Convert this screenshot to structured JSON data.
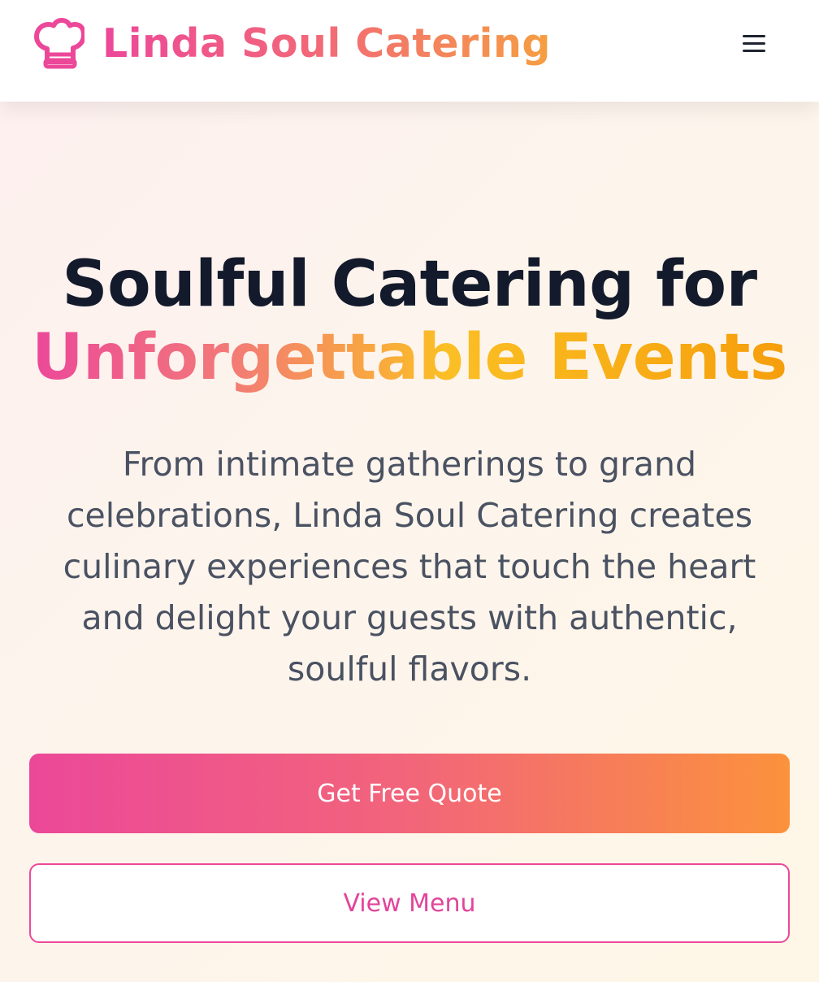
{
  "header": {
    "logo_icon": "chef-hat-icon",
    "brand_name": "Linda Soul Catering",
    "menu_icon": "hamburger-menu-icon"
  },
  "hero": {
    "headline_line1": "Soulful Catering for",
    "headline_line2": "Unforgettable Events",
    "description": "From intimate gatherings to grand celebrations, Linda Soul Catering creates culinary experiences that touch the heart and delight your guests with authentic, soulful flavors.",
    "primary_button_label": "Get Free Quote",
    "secondary_button_label": "View Menu"
  },
  "colors": {
    "brand_pink": "#ec4899",
    "brand_orange": "#fb923c",
    "brand_yellow": "#fbbf24",
    "heading_dark": "#131a2b",
    "body_text": "#4a5262"
  }
}
